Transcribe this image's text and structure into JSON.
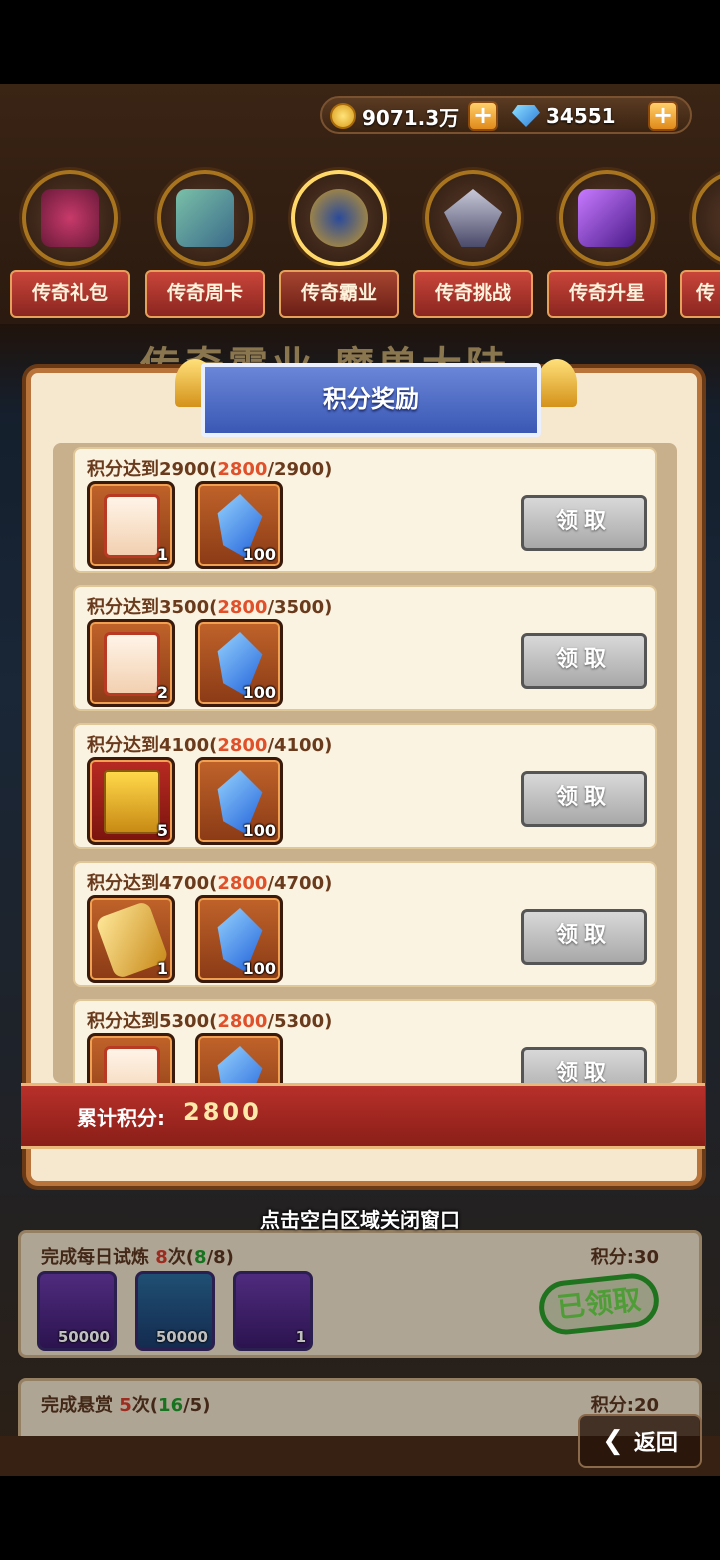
{
  "currency": {
    "gold": "9071.3万",
    "gems": "34551"
  },
  "nav": [
    {
      "label": "传奇礼包",
      "icon": "gift-bag-icon",
      "active": false
    },
    {
      "label": "传奇周卡",
      "icon": "weekly-card-icon",
      "active": false
    },
    {
      "label": "传奇霸业",
      "icon": "hegemony-icon",
      "active": true
    },
    {
      "label": "传奇挑战",
      "icon": "challenge-icon",
      "active": false
    },
    {
      "label": "传奇升星",
      "icon": "star-up-icon",
      "active": false
    },
    {
      "label": "传",
      "icon": "more-icon",
      "active": false
    }
  ],
  "banner_title": "传奇霸业 魔兽大陆",
  "modal": {
    "title": "积分奖励",
    "rows": [
      {
        "title_prefix": "积分达到2900(",
        "current": "2800",
        "title_suffix": "/2900)",
        "items": [
          {
            "icon": "scroll-icon",
            "count": "1"
          },
          {
            "icon": "crystal-icon",
            "count": "100"
          }
        ],
        "button": "领取"
      },
      {
        "title_prefix": "积分达到3500(",
        "current": "2800",
        "title_suffix": "/3500)",
        "items": [
          {
            "icon": "scroll-icon",
            "count": "2"
          },
          {
            "icon": "crystal-icon",
            "count": "100"
          }
        ],
        "button": "领取"
      },
      {
        "title_prefix": "积分达到4100(",
        "current": "2800",
        "title_suffix": "/4100)",
        "items": [
          {
            "icon": "book-icon",
            "count": "5"
          },
          {
            "icon": "crystal-icon",
            "count": "100"
          }
        ],
        "button": "领取"
      },
      {
        "title_prefix": "积分达到4700(",
        "current": "2800",
        "title_suffix": "/4700)",
        "items": [
          {
            "icon": "gold-scroll-icon",
            "count": "1"
          },
          {
            "icon": "crystal-icon",
            "count": "100"
          }
        ],
        "button": "领取"
      },
      {
        "title_prefix": "积分达到5300(",
        "current": "2800",
        "title_suffix": "/5300)",
        "items": [
          {
            "icon": "scroll-icon",
            "count": ""
          },
          {
            "icon": "crystal-icon",
            "count": ""
          }
        ],
        "button": "领取"
      }
    ],
    "total_label": "累计积分:",
    "total_value": "2800"
  },
  "close_hint": "点击空白区域关闭窗口",
  "tasks": [
    {
      "title": "完成每日试炼",
      "times": "8",
      "unit": "次(",
      "done": "8",
      "req": "/8)",
      "points": "积分:30",
      "items": [
        "50000",
        "50000",
        "1"
      ],
      "stamp": "已领取"
    },
    {
      "title": "完成悬赏",
      "times": "5",
      "unit": "次(",
      "done": "16",
      "req": "/5)",
      "points": "积分:20"
    }
  ],
  "back_label": "返回"
}
